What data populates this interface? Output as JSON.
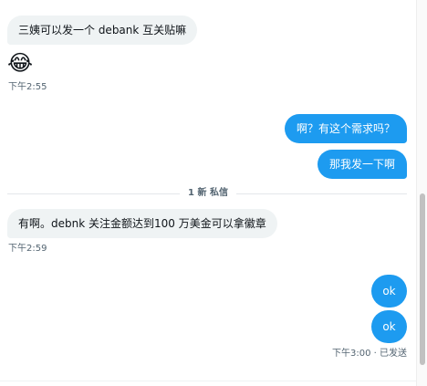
{
  "messages": {
    "m1": {
      "text": "三姨可以发一个 debank 互关贴嘛"
    },
    "m1_emoji": {
      "text": "😂"
    },
    "m1_time": {
      "text": "下午2:55"
    },
    "m2": {
      "text": "啊？有这个需求吗？"
    },
    "m3": {
      "text": "那我发一下啊"
    },
    "divider": {
      "text": "1 新 私信"
    },
    "m4": {
      "text": "有啊。debnk 关注金额达到100 万美金可以拿徽章"
    },
    "m4_time": {
      "text": "下午2:59"
    },
    "m5": {
      "text": "ok"
    },
    "m6": {
      "text": "ok"
    },
    "m6_status": {
      "text": "下午3:00 · 已发送"
    }
  },
  "colors": {
    "outgoing_bubble": "#1d9bf0",
    "incoming_bubble": "#eff3f4",
    "meta_text": "#536471"
  }
}
